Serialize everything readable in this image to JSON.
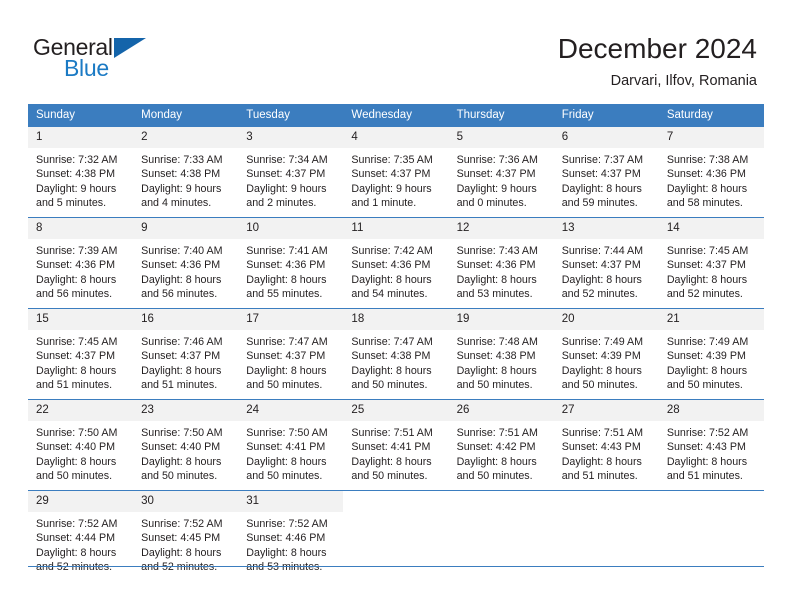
{
  "brand": {
    "name_top": "General",
    "name_bottom": "Blue",
    "color_dark": "#231f20",
    "color_blue": "#1b7ac4",
    "triangle_color": "#1464aa"
  },
  "header": {
    "month_title": "December 2024",
    "location": "Darvari, Ilfov, Romania"
  },
  "calendar": {
    "header_bg": "#3b7dbf",
    "daynum_bg": "#f2f2f2",
    "weekday_headers": [
      "Sunday",
      "Monday",
      "Tuesday",
      "Wednesday",
      "Thursday",
      "Friday",
      "Saturday"
    ],
    "weeks": [
      [
        {
          "day": "1",
          "sunrise": "Sunrise: 7:32 AM",
          "sunset": "Sunset: 4:38 PM",
          "daylight_line1": "Daylight: 9 hours",
          "daylight_line2": "and 5 minutes."
        },
        {
          "day": "2",
          "sunrise": "Sunrise: 7:33 AM",
          "sunset": "Sunset: 4:38 PM",
          "daylight_line1": "Daylight: 9 hours",
          "daylight_line2": "and 4 minutes."
        },
        {
          "day": "3",
          "sunrise": "Sunrise: 7:34 AM",
          "sunset": "Sunset: 4:37 PM",
          "daylight_line1": "Daylight: 9 hours",
          "daylight_line2": "and 2 minutes."
        },
        {
          "day": "4",
          "sunrise": "Sunrise: 7:35 AM",
          "sunset": "Sunset: 4:37 PM",
          "daylight_line1": "Daylight: 9 hours",
          "daylight_line2": "and 1 minute."
        },
        {
          "day": "5",
          "sunrise": "Sunrise: 7:36 AM",
          "sunset": "Sunset: 4:37 PM",
          "daylight_line1": "Daylight: 9 hours",
          "daylight_line2": "and 0 minutes."
        },
        {
          "day": "6",
          "sunrise": "Sunrise: 7:37 AM",
          "sunset": "Sunset: 4:37 PM",
          "daylight_line1": "Daylight: 8 hours",
          "daylight_line2": "and 59 minutes."
        },
        {
          "day": "7",
          "sunrise": "Sunrise: 7:38 AM",
          "sunset": "Sunset: 4:36 PM",
          "daylight_line1": "Daylight: 8 hours",
          "daylight_line2": "and 58 minutes."
        }
      ],
      [
        {
          "day": "8",
          "sunrise": "Sunrise: 7:39 AM",
          "sunset": "Sunset: 4:36 PM",
          "daylight_line1": "Daylight: 8 hours",
          "daylight_line2": "and 56 minutes."
        },
        {
          "day": "9",
          "sunrise": "Sunrise: 7:40 AM",
          "sunset": "Sunset: 4:36 PM",
          "daylight_line1": "Daylight: 8 hours",
          "daylight_line2": "and 56 minutes."
        },
        {
          "day": "10",
          "sunrise": "Sunrise: 7:41 AM",
          "sunset": "Sunset: 4:36 PM",
          "daylight_line1": "Daylight: 8 hours",
          "daylight_line2": "and 55 minutes."
        },
        {
          "day": "11",
          "sunrise": "Sunrise: 7:42 AM",
          "sunset": "Sunset: 4:36 PM",
          "daylight_line1": "Daylight: 8 hours",
          "daylight_line2": "and 54 minutes."
        },
        {
          "day": "12",
          "sunrise": "Sunrise: 7:43 AM",
          "sunset": "Sunset: 4:36 PM",
          "daylight_line1": "Daylight: 8 hours",
          "daylight_line2": "and 53 minutes."
        },
        {
          "day": "13",
          "sunrise": "Sunrise: 7:44 AM",
          "sunset": "Sunset: 4:37 PM",
          "daylight_line1": "Daylight: 8 hours",
          "daylight_line2": "and 52 minutes."
        },
        {
          "day": "14",
          "sunrise": "Sunrise: 7:45 AM",
          "sunset": "Sunset: 4:37 PM",
          "daylight_line1": "Daylight: 8 hours",
          "daylight_line2": "and 52 minutes."
        }
      ],
      [
        {
          "day": "15",
          "sunrise": "Sunrise: 7:45 AM",
          "sunset": "Sunset: 4:37 PM",
          "daylight_line1": "Daylight: 8 hours",
          "daylight_line2": "and 51 minutes."
        },
        {
          "day": "16",
          "sunrise": "Sunrise: 7:46 AM",
          "sunset": "Sunset: 4:37 PM",
          "daylight_line1": "Daylight: 8 hours",
          "daylight_line2": "and 51 minutes."
        },
        {
          "day": "17",
          "sunrise": "Sunrise: 7:47 AM",
          "sunset": "Sunset: 4:37 PM",
          "daylight_line1": "Daylight: 8 hours",
          "daylight_line2": "and 50 minutes."
        },
        {
          "day": "18",
          "sunrise": "Sunrise: 7:47 AM",
          "sunset": "Sunset: 4:38 PM",
          "daylight_line1": "Daylight: 8 hours",
          "daylight_line2": "and 50 minutes."
        },
        {
          "day": "19",
          "sunrise": "Sunrise: 7:48 AM",
          "sunset": "Sunset: 4:38 PM",
          "daylight_line1": "Daylight: 8 hours",
          "daylight_line2": "and 50 minutes."
        },
        {
          "day": "20",
          "sunrise": "Sunrise: 7:49 AM",
          "sunset": "Sunset: 4:39 PM",
          "daylight_line1": "Daylight: 8 hours",
          "daylight_line2": "and 50 minutes."
        },
        {
          "day": "21",
          "sunrise": "Sunrise: 7:49 AM",
          "sunset": "Sunset: 4:39 PM",
          "daylight_line1": "Daylight: 8 hours",
          "daylight_line2": "and 50 minutes."
        }
      ],
      [
        {
          "day": "22",
          "sunrise": "Sunrise: 7:50 AM",
          "sunset": "Sunset: 4:40 PM",
          "daylight_line1": "Daylight: 8 hours",
          "daylight_line2": "and 50 minutes."
        },
        {
          "day": "23",
          "sunrise": "Sunrise: 7:50 AM",
          "sunset": "Sunset: 4:40 PM",
          "daylight_line1": "Daylight: 8 hours",
          "daylight_line2": "and 50 minutes."
        },
        {
          "day": "24",
          "sunrise": "Sunrise: 7:50 AM",
          "sunset": "Sunset: 4:41 PM",
          "daylight_line1": "Daylight: 8 hours",
          "daylight_line2": "and 50 minutes."
        },
        {
          "day": "25",
          "sunrise": "Sunrise: 7:51 AM",
          "sunset": "Sunset: 4:41 PM",
          "daylight_line1": "Daylight: 8 hours",
          "daylight_line2": "and 50 minutes."
        },
        {
          "day": "26",
          "sunrise": "Sunrise: 7:51 AM",
          "sunset": "Sunset: 4:42 PM",
          "daylight_line1": "Daylight: 8 hours",
          "daylight_line2": "and 50 minutes."
        },
        {
          "day": "27",
          "sunrise": "Sunrise: 7:51 AM",
          "sunset": "Sunset: 4:43 PM",
          "daylight_line1": "Daylight: 8 hours",
          "daylight_line2": "and 51 minutes."
        },
        {
          "day": "28",
          "sunrise": "Sunrise: 7:52 AM",
          "sunset": "Sunset: 4:43 PM",
          "daylight_line1": "Daylight: 8 hours",
          "daylight_line2": "and 51 minutes."
        }
      ],
      [
        {
          "day": "29",
          "sunrise": "Sunrise: 7:52 AM",
          "sunset": "Sunset: 4:44 PM",
          "daylight_line1": "Daylight: 8 hours",
          "daylight_line2": "and 52 minutes."
        },
        {
          "day": "30",
          "sunrise": "Sunrise: 7:52 AM",
          "sunset": "Sunset: 4:45 PM",
          "daylight_line1": "Daylight: 8 hours",
          "daylight_line2": "and 52 minutes."
        },
        {
          "day": "31",
          "sunrise": "Sunrise: 7:52 AM",
          "sunset": "Sunset: 4:46 PM",
          "daylight_line1": "Daylight: 8 hours",
          "daylight_line2": "and 53 minutes."
        },
        {
          "day": "",
          "sunrise": "",
          "sunset": "",
          "daylight_line1": "",
          "daylight_line2": ""
        },
        {
          "day": "",
          "sunrise": "",
          "sunset": "",
          "daylight_line1": "",
          "daylight_line2": ""
        },
        {
          "day": "",
          "sunrise": "",
          "sunset": "",
          "daylight_line1": "",
          "daylight_line2": ""
        },
        {
          "day": "",
          "sunrise": "",
          "sunset": "",
          "daylight_line1": "",
          "daylight_line2": ""
        }
      ]
    ]
  }
}
